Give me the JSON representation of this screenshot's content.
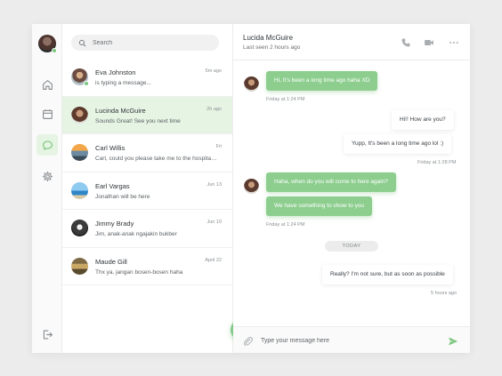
{
  "colors": {
    "accent": "#82c98a",
    "bubble_in": "#8dce8f",
    "active_bg": "#e6f4e4",
    "online": "#7bc67e"
  },
  "search": {
    "placeholder": "Search",
    "icon": "search-icon"
  },
  "sidebar": {
    "items": [
      {
        "icon": "home-icon"
      },
      {
        "icon": "calendar-icon"
      },
      {
        "icon": "chat-icon",
        "active": true
      },
      {
        "icon": "settings-icon"
      },
      {
        "icon": "logout-icon"
      }
    ]
  },
  "contacts": [
    {
      "name": "Eva Johnston",
      "preview": "is typing a message...",
      "time": "5m ago",
      "online": true
    },
    {
      "name": "Lucinda McGuire",
      "preview": "Sounds Great! See you next time",
      "time": "2h ago",
      "active": true
    },
    {
      "name": "Carl Willis",
      "preview": "Carl, could you please take me to the hospital tomorrow?",
      "time": "Fri"
    },
    {
      "name": "Earl Vargas",
      "preview": "Jonathan will be here",
      "time": "Jun 13"
    },
    {
      "name": "Jimmy Brady",
      "preview": "Jim, anak-anak ngajakin bukber",
      "time": "Jun 10"
    },
    {
      "name": "Maude Gill",
      "preview": "Thx ya, jangan bosen-bosen haha",
      "time": "April 22"
    }
  ],
  "new_chat": {
    "label": "+"
  },
  "chat": {
    "title": "Lucida McGuire",
    "subtitle": "Last seen 2 hours ago",
    "header_icons": [
      "phone-icon",
      "video-icon",
      "more-icon"
    ],
    "messages": [
      {
        "dir": "in",
        "text": "Hi, It's been a long time ago haha XD"
      },
      {
        "dir": "stamp_in",
        "text": "Friday at 1:24 PM"
      },
      {
        "dir": "out",
        "text": "Hi!! How are you?"
      },
      {
        "dir": "out",
        "text": "Yupp, It's been a long time ago lol :)"
      },
      {
        "dir": "stamp_out",
        "text": "Friday at 1:28 PM"
      },
      {
        "dir": "in",
        "text": "Haha, when do you will come to here again?"
      },
      {
        "dir": "in",
        "text": "We have something to show to you"
      },
      {
        "dir": "stamp_in",
        "text": "Friday at 1:24 PM"
      },
      {
        "dir": "out",
        "text": "Really? I'm not sure, but as soon as possible"
      },
      {
        "dir": "stamp_out",
        "text": "5 hours ago"
      }
    ],
    "divider": "TODAY"
  },
  "composer": {
    "placeholder": "Type your message here"
  }
}
